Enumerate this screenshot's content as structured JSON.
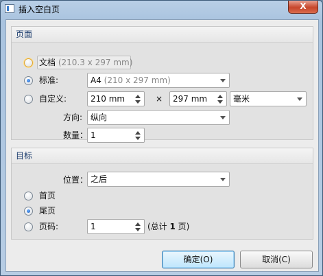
{
  "window": {
    "title": "插入空白页",
    "close_label": "X"
  },
  "page_group": {
    "header": "页面",
    "doc_radio": {
      "label": "文档",
      "size": "(210.3 x 297 mm)"
    },
    "standard_radio": {
      "label": "标准:",
      "value_main": "A4",
      "value_dim": "(210 x 297 mm)"
    },
    "custom_radio": {
      "label": "自定义:",
      "width": "210 mm",
      "times": "×",
      "height": "297 mm",
      "unit": "毫米"
    },
    "orientation": {
      "label": "方向:",
      "value": "纵向"
    },
    "count": {
      "label": "数量：",
      "value": "1"
    }
  },
  "target_group": {
    "header": "目标",
    "position": {
      "label": "位置：",
      "value": "之后"
    },
    "first_page": {
      "label": "首页"
    },
    "last_page": {
      "label": "尾页"
    },
    "page_number": {
      "label": "页码:",
      "value": "1",
      "total_prefix": "(总计 ",
      "total_count": "1",
      "total_suffix": " 页)"
    }
  },
  "buttons": {
    "ok": "确定(O)",
    "cancel": "取消(C)"
  },
  "selection": {
    "radio_page": "standard",
    "radio_target": "last"
  }
}
